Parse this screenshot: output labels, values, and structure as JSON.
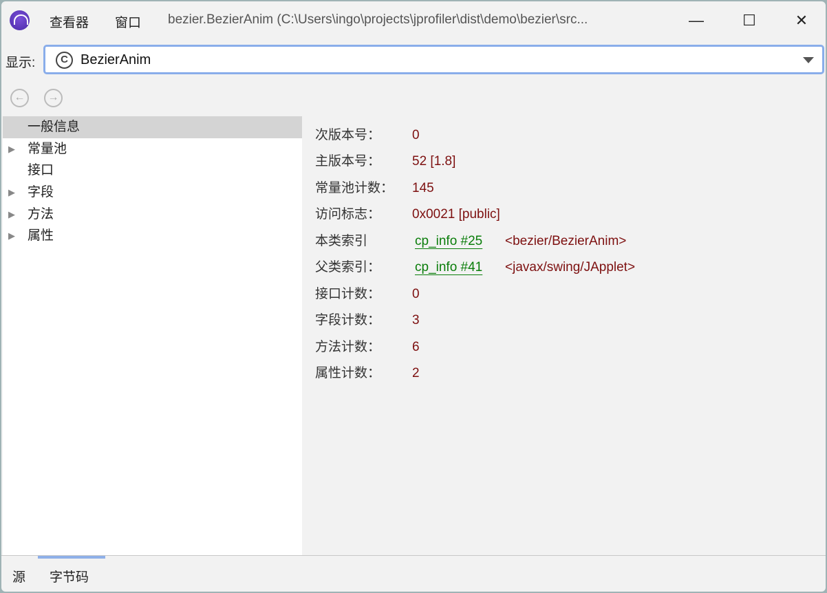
{
  "titlebar": {
    "menu": [
      "查看器",
      "窗口"
    ],
    "title": "bezier.BezierAnim (C:\\Users\\ingo\\projects\\jprofiler\\dist\\demo\\bezier\\src...",
    "minimize": "—",
    "maximize": "☐",
    "close": "✕"
  },
  "selector": {
    "label": "显示:",
    "value": "BezierAnim",
    "class_icon": "C"
  },
  "nav": {
    "back": "←",
    "forward": "→"
  },
  "tree": [
    {
      "label": "一般信息",
      "expandable": false,
      "selected": true
    },
    {
      "label": "常量池",
      "expandable": true
    },
    {
      "label": "接口",
      "expandable": false
    },
    {
      "label": "字段",
      "expandable": true
    },
    {
      "label": "方法",
      "expandable": true
    },
    {
      "label": "属性",
      "expandable": true
    }
  ],
  "info": [
    {
      "label": "次版本号：",
      "value": "0"
    },
    {
      "label": "主版本号：",
      "value": "52 [1.8]"
    },
    {
      "label": "常量池计数：",
      "value": "145"
    },
    {
      "label": "访问标志：",
      "value": "0x0021 [public]"
    },
    {
      "label": "本类索引",
      "link": "cp_info #25",
      "extra": "<bezier/BezierAnim>"
    },
    {
      "label": "父类索引：",
      "link": "cp_info #41",
      "extra": "<javax/swing/JApplet>"
    },
    {
      "label": "接口计数：",
      "value": "0"
    },
    {
      "label": "字段计数：",
      "value": "3"
    },
    {
      "label": "方法计数：",
      "value": "6"
    },
    {
      "label": "属性计数：",
      "value": "2"
    }
  ],
  "tabs": [
    "源",
    "字节码"
  ],
  "tree_arrow": "▶"
}
